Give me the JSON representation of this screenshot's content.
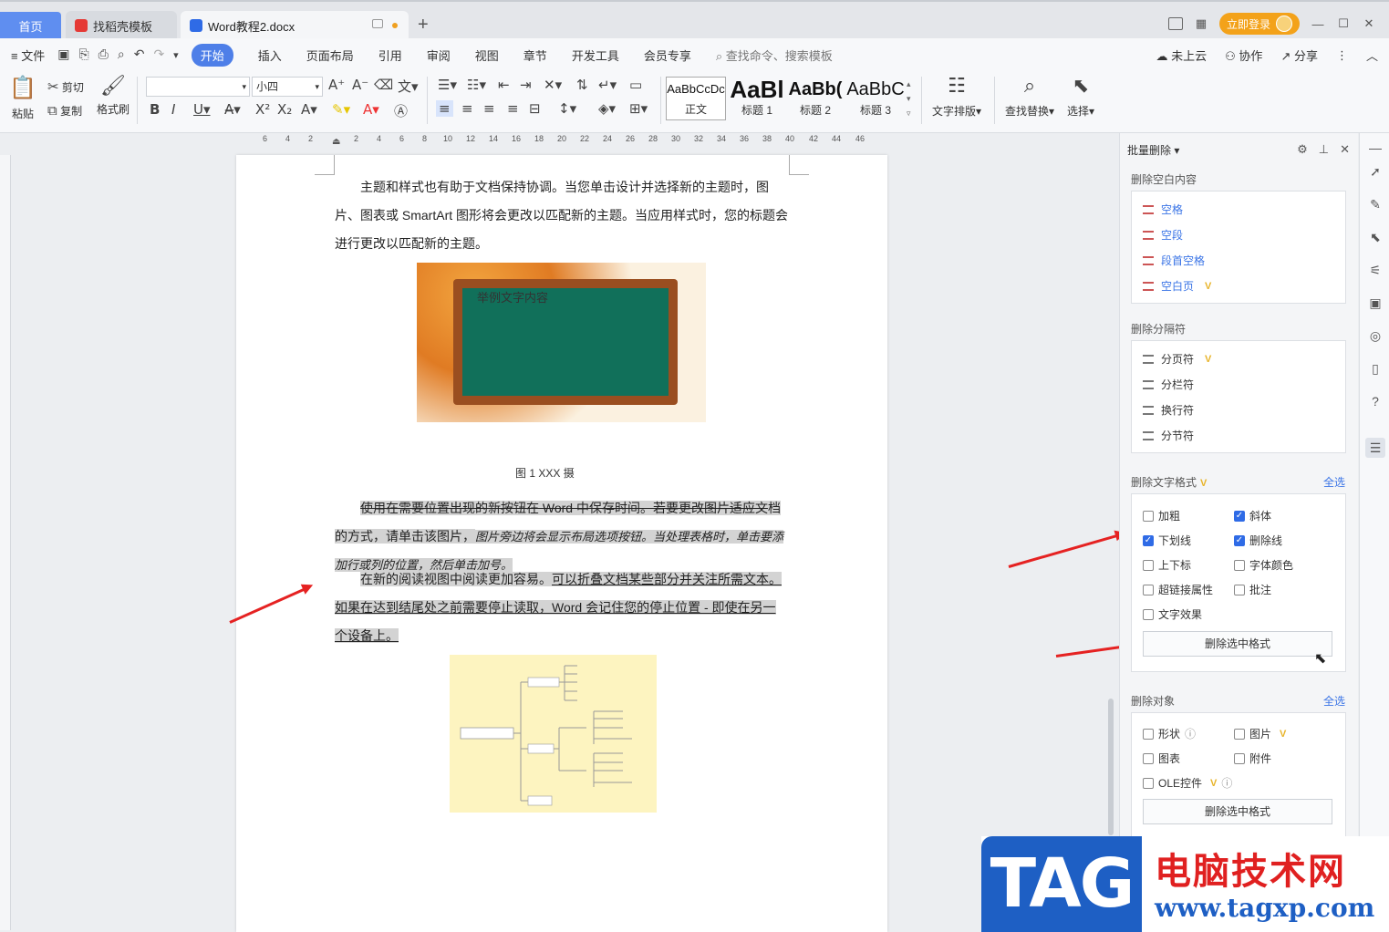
{
  "tabs": {
    "home": "首页",
    "template": "找稻壳模板",
    "document": "Word教程2.docx"
  },
  "titlebar": {
    "login": "立即登录"
  },
  "menu": {
    "file": "文件",
    "items": [
      "开始",
      "插入",
      "页面布局",
      "引用",
      "审阅",
      "视图",
      "章节",
      "开发工具",
      "会员专享"
    ],
    "search": "查找命令、搜索模板",
    "cloud": "未上云",
    "collab": "协作",
    "share": "分享"
  },
  "ribbon": {
    "paste": "粘贴",
    "cut": "剪切",
    "copy": "复制",
    "format_painter": "格式刷",
    "font_name": "",
    "font_size": "小四",
    "styles": [
      {
        "preview": "AaBbCcDc",
        "label": "正文"
      },
      {
        "preview": "AaBl",
        "label": "标题 1"
      },
      {
        "preview": "AaBb(",
        "label": "标题 2"
      },
      {
        "preview": "AaBbC",
        "label": "标题 3"
      }
    ],
    "text_layout": "文字排版",
    "find_replace": "查找替换",
    "select": "选择"
  },
  "ruler": {
    "ticks": [
      "6",
      "4",
      "2",
      "2",
      "4",
      "6",
      "8",
      "10",
      "12",
      "14",
      "16",
      "18",
      "20",
      "22",
      "24",
      "26",
      "28",
      "30",
      "32",
      "34",
      "36",
      "38",
      "40",
      "42",
      "44",
      "46"
    ]
  },
  "document": {
    "para1": "主题和样式也有助于文档保持协调。当您单击设计并选择新的主题时，图片、图表或 SmartArt 图形将会更改以匹配新的主题。当应用样式时，您的标题会进行更改以匹配新的主题。",
    "board_text": "举例文字内容",
    "caption": "图 1    XXX 摄",
    "para2_strike": "使用在需要位置出现的新按钮在 Word 中保存时间。若要更改图片适应文",
    "para2_normal": "档的方式，请单击该图片，",
    "para2_italic": "图片旁边将会显示布局选项按钮。当处理表格时，单击要添加行或列的位置，然后单击加号。",
    "para3_a": "在新的阅读视图中阅读更加容易。",
    "para3_b": "可以折叠文档某些部分并关注所需文本。如果在达到结尾处之前需要停止读取，Word 会记住您的停止位置 - 即使在另一个设备上。"
  },
  "panel": {
    "title": "批量删除",
    "sec_blank": "删除空白内容",
    "blank_items": [
      "空格",
      "空段",
      "段首空格",
      "空白页"
    ],
    "sec_sep": "删除分隔符",
    "sep_items": [
      "分页符",
      "分栏符",
      "换行符",
      "分节符"
    ],
    "sec_format": "删除文字格式",
    "select_all": "全选",
    "format_opts": [
      {
        "label": "加粗",
        "checked": false
      },
      {
        "label": "斜体",
        "checked": true
      },
      {
        "label": "下划线",
        "checked": true
      },
      {
        "label": "删除线",
        "checked": true
      },
      {
        "label": "上下标",
        "checked": false
      },
      {
        "label": "字体颜色",
        "checked": false
      },
      {
        "label": "超链接属性",
        "checked": false
      },
      {
        "label": "批注",
        "checked": false
      },
      {
        "label": "文字效果",
        "checked": false
      }
    ],
    "delete_format_btn": "删除选中格式",
    "sec_obj": "删除对象",
    "obj_opts": [
      {
        "label": "形状",
        "checked": false
      },
      {
        "label": "图片",
        "checked": false
      },
      {
        "label": "图表",
        "checked": false
      },
      {
        "label": "附件",
        "checked": false
      },
      {
        "label": "OLE控件",
        "checked": false
      }
    ],
    "delete_obj_btn": "删除选中格式",
    "vip": "V"
  },
  "watermark": {
    "badge": "TAG",
    "cn": "电脑技术网",
    "url": "www.tagxp.com"
  },
  "colors": {
    "accent": "#4e7fe8",
    "checkbox": "#2f6be6",
    "arrow": "#e52222",
    "highlight": "#d3d3d3"
  }
}
